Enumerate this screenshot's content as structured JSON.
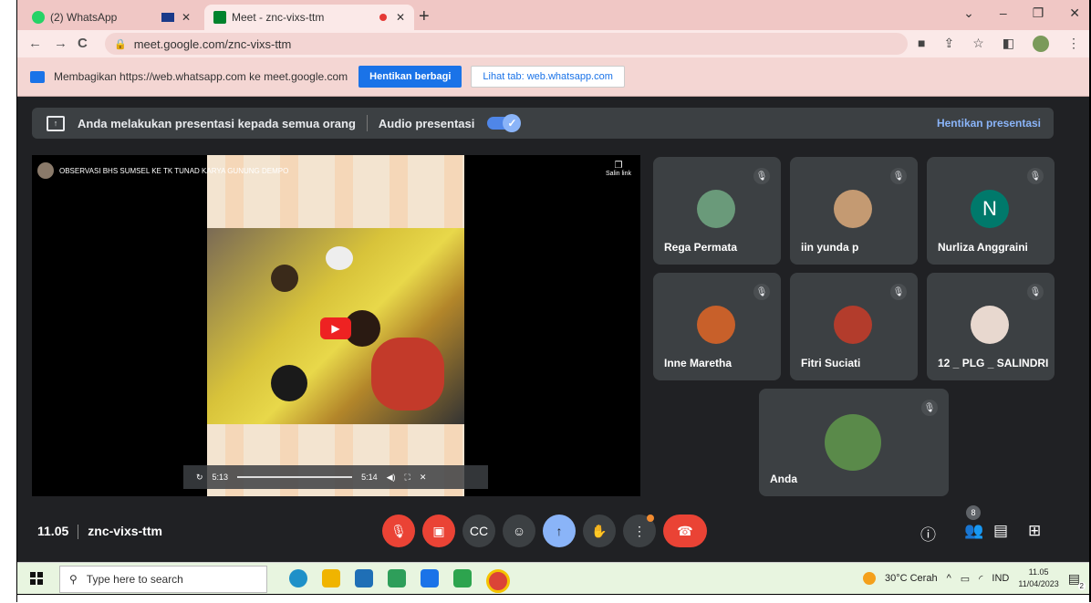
{
  "browser": {
    "tabs": [
      {
        "label": "(2) WhatsApp",
        "icon": "whatsapp-icon",
        "color": "#25d366"
      },
      {
        "label": "Meet - znc-vixs-ttm",
        "icon": "meet-icon",
        "color": "#00832d"
      }
    ],
    "url": "meet.google.com/znc-vixs-ttm"
  },
  "share_bar": {
    "message": "Membagikan https://web.whatsapp.com ke meet.google.com",
    "stop_label": "Hentikan berbagi",
    "view_tab_label": "Lihat tab: web.whatsapp.com"
  },
  "presenting": {
    "message": "Anda melakukan presentasi kepada semua orang",
    "audio_label": "Audio presentasi",
    "stop_label": "Hentikan presentasi"
  },
  "video": {
    "title": "OBSERVASI BHS SUMSEL KE TK TUNAD KARYA GUNUNG DEMPO",
    "copy_link": "Salin link",
    "current_time": "5:13",
    "total_time": "5:14",
    "progress": 0.99
  },
  "participants": [
    {
      "name": "Rega Permata",
      "muted": true,
      "avatar_color": "#6a9a7a"
    },
    {
      "name": "iin yunda p",
      "muted": true,
      "avatar_color": "#c49a72"
    },
    {
      "name": "Nurliza Anggraini",
      "muted": true,
      "initial": "N",
      "avatar_color": "#00796b"
    },
    {
      "name": "Inne Maretha",
      "muted": true,
      "avatar_color": "#c8602a"
    },
    {
      "name": "Fitri Suciati",
      "muted": true,
      "avatar_color": "#b33c2c"
    },
    {
      "name": "12 _ PLG _ SALINDRI",
      "muted": true,
      "avatar_color": "#e8d8cf"
    },
    {
      "name": "Anda",
      "muted": true,
      "avatar_color": "#5a8a4a"
    }
  ],
  "meeting": {
    "time": "11.05",
    "code": "znc-vixs-ttm",
    "participant_count": "8"
  },
  "taskbar": {
    "search_placeholder": "Type here to search",
    "weather": "30°C Cerah",
    "language": "IND",
    "time": "11.05",
    "date": "11/04/2023",
    "notification_count": "2"
  }
}
